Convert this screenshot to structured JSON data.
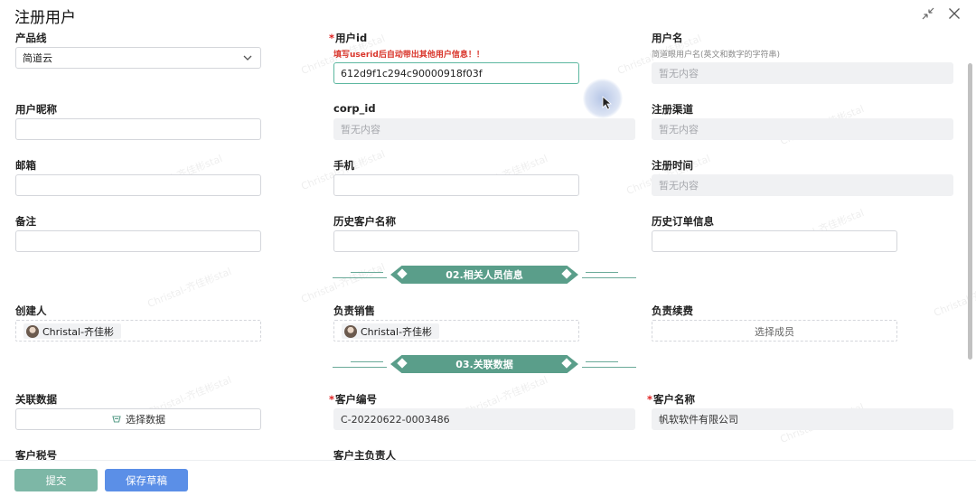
{
  "dialog": {
    "title": "注册用户"
  },
  "header_icons": {
    "shrink": "shrink-icon",
    "close": "close-icon"
  },
  "fields": {
    "product_line": {
      "label": "产品线",
      "value": "简道云"
    },
    "user_id": {
      "label": "用户id",
      "required": "*",
      "hint": "填写userid后自动带出其他用户信息！！",
      "value": "612d9f1c294c90000918f03f"
    },
    "username": {
      "label": "用户名",
      "hint": "简道眼用户名(英文和数字的字符串)",
      "placeholder": "暂无内容"
    },
    "nickname": {
      "label": "用户昵称",
      "value": ""
    },
    "corp_id": {
      "label": "corp_id",
      "placeholder": "暂无内容"
    },
    "reg_channel": {
      "label": "注册渠道",
      "placeholder": "暂无内容"
    },
    "email": {
      "label": "邮箱",
      "value": ""
    },
    "phone": {
      "label": "手机",
      "value": ""
    },
    "reg_time": {
      "label": "注册时间",
      "placeholder": "暂无内容"
    },
    "remark": {
      "label": "备注",
      "value": ""
    },
    "history_customer": {
      "label": "历史客户名称",
      "value": ""
    },
    "history_order": {
      "label": "历史订单信息",
      "value": ""
    }
  },
  "sections": {
    "related_people": "02.相关人员信息",
    "related_data": "03.关联数据"
  },
  "people": {
    "creator": {
      "label": "创建人",
      "member": "Christal-齐佳彬"
    },
    "sales": {
      "label": "负责销售",
      "member": "Christal-齐佳彬"
    },
    "renewal": {
      "label": "负责续费",
      "placeholder": "选择成员"
    }
  },
  "related": {
    "data": {
      "label": "关联数据",
      "button": "选择数据"
    },
    "customer_no": {
      "label": "客户编号",
      "required": "*",
      "value": "C-20220622-0003486"
    },
    "customer_name": {
      "label": "客户名称",
      "required": "*",
      "value": "帆软软件有限公司"
    },
    "tax_no": {
      "label": "客户税号"
    },
    "owner": {
      "label": "客户主负责人"
    }
  },
  "footer": {
    "submit": "提交",
    "save_draft": "保存草稿"
  },
  "watermark": "Christal-齐佳彬stal",
  "colors": {
    "accent": "#5a9e8a",
    "required": "#e02020",
    "primary_button": "#5b8fe7",
    "submit_button": "#7db7a6"
  }
}
